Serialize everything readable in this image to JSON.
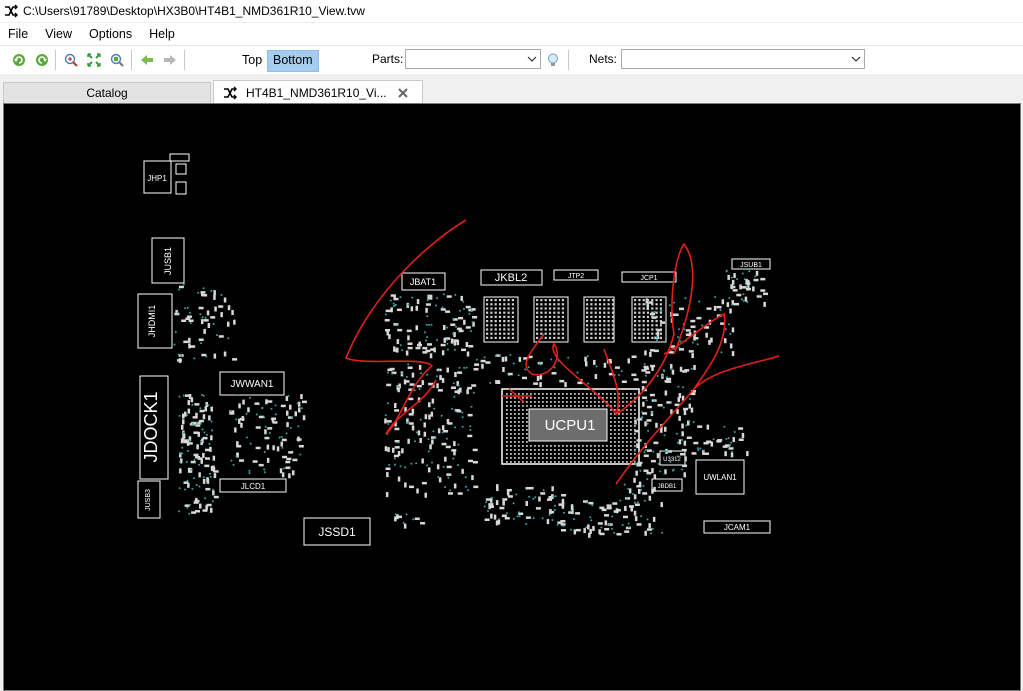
{
  "window": {
    "title": "C:\\Users\\91789\\Desktop\\HX3B0\\HT4B1_NMD361R10_View.tvw"
  },
  "menu": [
    "File",
    "View",
    "Options",
    "Help"
  ],
  "toolbar": {
    "side_top": "Top",
    "side_bottom": "Bottom",
    "side_selected": "Bottom",
    "parts_label": "Parts:",
    "parts_value": "",
    "nets_label": "Nets:",
    "nets_value": ""
  },
  "tabs": [
    {
      "label": "Catalog",
      "active": false
    },
    {
      "label": "HT4B1_NMD361R10_Vi...",
      "active": true
    }
  ],
  "board": {
    "background": "#000000",
    "trace_color": "#ffffff",
    "annotation_color": "#e0201a",
    "labels": [
      "JHP1",
      "JUSB1",
      "JHDMI1",
      "JDOCK1",
      "JUSB3",
      "JWWAN1",
      "JLCD1",
      "JSSD1",
      "JBAT1",
      "JKBL2",
      "JTP2",
      "JCP1",
      "JSUB1",
      "UCPU1",
      "UWLAN1",
      "U3312",
      "JBDB1",
      "JCAM1"
    ]
  }
}
